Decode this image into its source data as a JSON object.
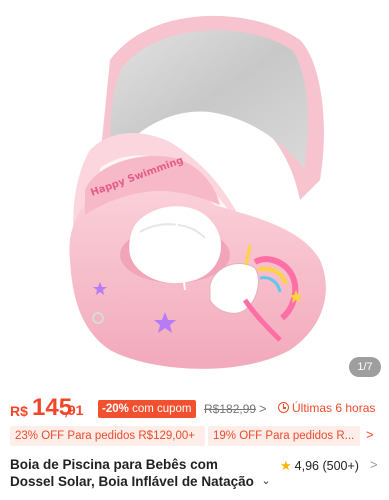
{
  "gallery": {
    "counter": "1/7",
    "image_alt": "Pink inflatable baby swim float with sun canopy and unicorn print",
    "float_text": "Happy Swimming",
    "colors": {
      "canopy_pink": "#f6c3cf",
      "canopy_mirror": "#cfcfcf",
      "float_pink": "#f7b9c8",
      "float_light": "#fbd6de"
    }
  },
  "price": {
    "currency": "R$",
    "integer": "145",
    "decimal": ",91",
    "discount": "-20%",
    "coupon_label": "com cupom",
    "original": "R$182,99",
    "original_chevron": ">",
    "deadline": "Últimas 6 horas"
  },
  "promos": {
    "items": [
      "23% OFF Para pedidos R$129,00+",
      "19% OFF Para pedidos R..."
    ],
    "chevron": ">"
  },
  "product": {
    "title_line1": "Boia de Piscina para Bebês com",
    "title_line2": "Dossel Solar, Boia Inflável de Natação",
    "expand_chevron": "⌄",
    "rating": "4,96",
    "reviews": "(500+)",
    "rating_chevron": ">"
  },
  "colors": {
    "price_red": "#f2462a",
    "promo_bg": "#fdeee9",
    "star": "#f7b500"
  }
}
